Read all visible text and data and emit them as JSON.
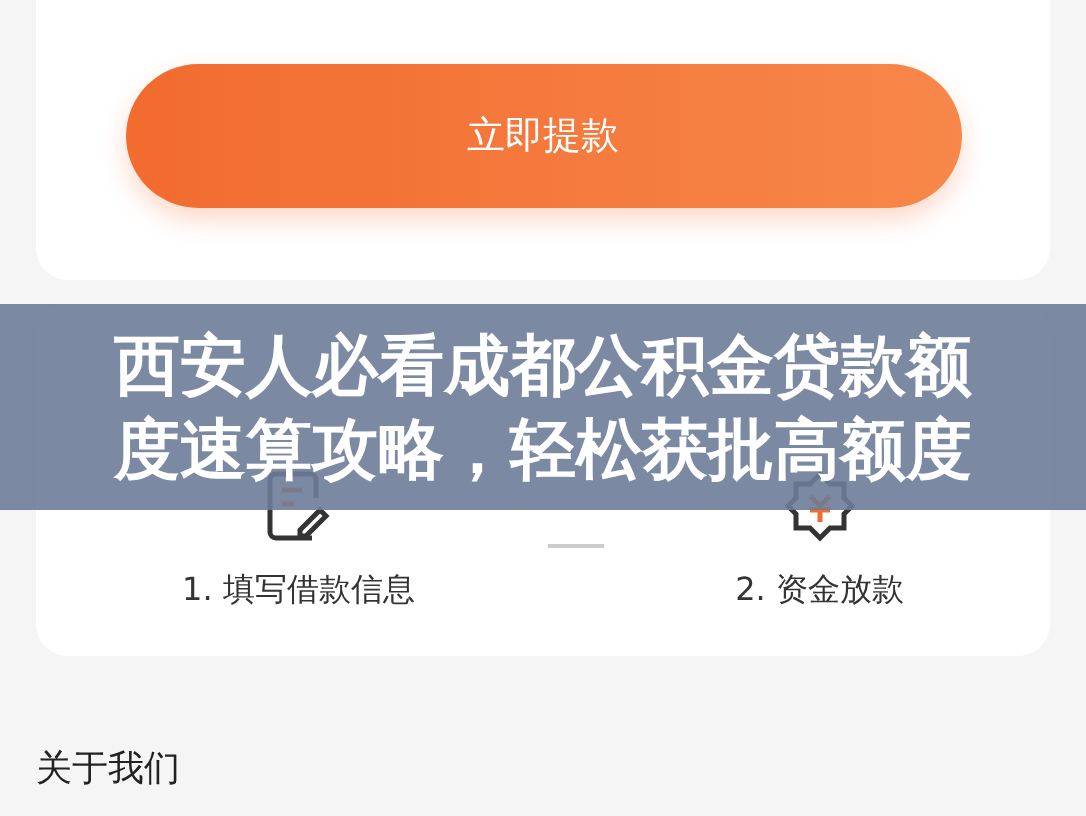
{
  "withdraw_button": {
    "label": "立即提款"
  },
  "steps": [
    {
      "kind": "form",
      "label": "1. 填写借款信息"
    },
    {
      "kind": "money",
      "label": "2. 资金放款"
    }
  ],
  "section_title": "关于我们",
  "banner": {
    "title": "西安人必看成都公积金贷款额度速算攻略，轻松获批高额度"
  }
}
